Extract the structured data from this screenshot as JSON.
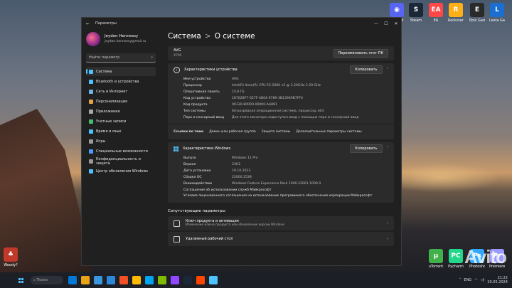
{
  "desktop": {
    "icons_top": [
      {
        "label": "Discord",
        "color": "#5865f2",
        "glyph": "◉"
      },
      {
        "label": "Steam",
        "color": "#1b2838",
        "glyph": "S"
      },
      {
        "label": "EA",
        "color": "#ff4747",
        "glyph": "EA"
      },
      {
        "label": "Rockstar Games Launcher",
        "color": "#fcaf17",
        "glyph": "R"
      },
      {
        "label": "Epic Games Launcher",
        "color": "#2a2a2a",
        "glyph": "E"
      },
      {
        "label": "Lesta Game Center",
        "color": "#1a6fd1",
        "glyph": "L"
      }
    ],
    "icons_bottom": [
      {
        "label": "uTorrent",
        "color": "#41b14a",
        "glyph": "μ"
      },
      {
        "label": "Pycharm",
        "color": "#21d789",
        "glyph": "PC"
      },
      {
        "label": "Photoshop",
        "color": "#31a8ff",
        "glyph": "Ps"
      },
      {
        "label": "Premiere",
        "color": "#9999ff",
        "glyph": "Pr"
      }
    ],
    "left_icon_label": "Woody?",
    "watermark": "Avito"
  },
  "taskbar": {
    "search_placeholder": "Поиск",
    "lang": "ENG",
    "time": "21:22",
    "date": "20.05.2024",
    "apps": [
      "#0078d4",
      "#e8a317",
      "#3a96dd",
      "#2b88d8",
      "#f25022",
      "#ffb900",
      "#00a4ef",
      "#7fba00",
      "#9146ff",
      "#1b2838",
      "#ff4500",
      "#4cc2ff"
    ]
  },
  "window": {
    "title": "Параметры",
    "user": {
      "name": "Jeydon Hennessy",
      "email": "jeydon.hennessy@mail.ru"
    },
    "search_placeholder": "Найти параметр",
    "nav": [
      {
        "label": "Система",
        "color": "#4cc2ff",
        "active": true
      },
      {
        "label": "Bluetooth и устройства",
        "color": "#4cc2ff"
      },
      {
        "label": "Сеть и Интернет",
        "color": "#6fb3e0"
      },
      {
        "label": "Персонализация",
        "color": "#e8a24a"
      },
      {
        "label": "Приложения",
        "color": "#a9a9a9"
      },
      {
        "label": "Учетные записи",
        "color": "#40c070"
      },
      {
        "label": "Время и язык",
        "color": "#4cc2ff"
      },
      {
        "label": "Игры",
        "color": "#9a9a9a"
      },
      {
        "label": "Специальные возможности",
        "color": "#4c9aff"
      },
      {
        "label": "Конфиденциальность и защита",
        "color": "#9a9a9a"
      },
      {
        "label": "Центр обновления Windows",
        "color": "#4cc2ff"
      }
    ],
    "breadcrumb": {
      "parent": "Система",
      "sep": ">",
      "current": "О системе"
    },
    "device": {
      "name": "AVG",
      "model": "X79C",
      "rename_button": "Переименовать этот ПК"
    },
    "device_specs": {
      "title": "Характеристики устройства",
      "copy_button": "Копировать",
      "rows": [
        {
          "k": "Имя устройства",
          "v": "AVG"
        },
        {
          "k": "Процессор",
          "v": "Intel(R) Xeon(R) CPU E5-2660 v2 @ 2.20GHz   2.20 GHz"
        },
        {
          "k": "Оперативная память",
          "v": "15,9 ГБ"
        },
        {
          "k": "Код устройства",
          "v": "18702BF7-5E7F-4B04-9789-3B13969B7FF0"
        },
        {
          "k": "Код продукта",
          "v": "00330-80000-00000-AA891"
        },
        {
          "k": "Тип системы",
          "v": "64-разрядная операционная система, процессор x64"
        },
        {
          "k": "Перо и сенсорный ввод",
          "v": "Для этого монитора недоступен ввод с помощью пера и сенсорный ввод"
        }
      ]
    },
    "links": {
      "label": "Ссылки по теме",
      "items": [
        "Домен или рабочая группа",
        "Защита системы",
        "Дополнительные параметры системы"
      ]
    },
    "windows_specs": {
      "title": "Характеристики Windows",
      "copy_button": "Копировать",
      "rows": [
        {
          "k": "Выпуск",
          "v": "Windows 11 Pro"
        },
        {
          "k": "Версия",
          "v": "23H2"
        },
        {
          "k": "Дата установки",
          "v": "19.10.2023"
        },
        {
          "k": "Сборка ОС",
          "v": "22000.2538"
        },
        {
          "k": "Взаимодействие",
          "v": "Windows Feature Experience Pack 1000.22001.1000.0"
        }
      ],
      "notes": [
        "Соглашение об использовании служб Майкрософт",
        "Условия лицензионного соглашения на использование программного обеспечения корпорации Майкрософт"
      ]
    },
    "related": {
      "title": "Сопутствующие параметры",
      "items": [
        {
          "title": "Ключ продукта и активация",
          "desc": "Изменение ключа продукта или обновление версии Windows"
        },
        {
          "title": "Удаленный рабочий стол",
          "desc": ""
        }
      ]
    }
  }
}
